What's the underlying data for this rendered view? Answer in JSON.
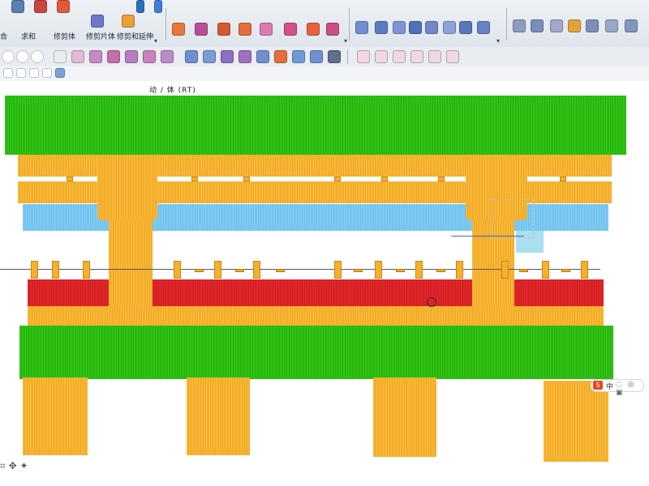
{
  "ribbon": {
    "commands": [
      {
        "name": "unite",
        "label": "合"
      },
      {
        "name": "subtract",
        "label": "求和"
      },
      {
        "name": "trim-body",
        "label": "修剪体"
      },
      {
        "name": "trim-sheet-body",
        "label": "修剪片体"
      },
      {
        "name": "trim-extend",
        "label": "修剪和延伸"
      }
    ],
    "colors": {
      "accent": "#2a6fbf",
      "ribbon_bg": "#e6ebf1"
    }
  },
  "part": {
    "title": "动 / 体 (RT)"
  },
  "status": {
    "ime": {
      "s": "S",
      "lang": "中"
    }
  },
  "model_colors": {
    "green_plate": "#2fc214",
    "yellow_plate": "#f7b733",
    "blue_plate": "#7fcaf2",
    "red_plate": "#e0262a"
  }
}
